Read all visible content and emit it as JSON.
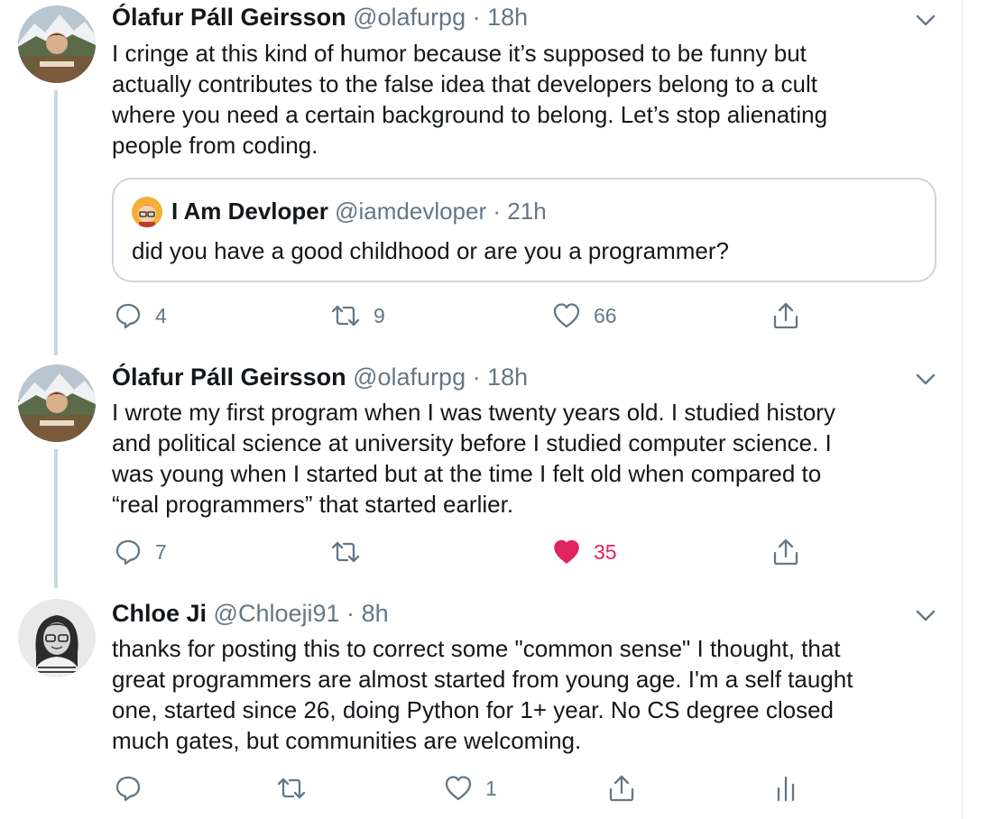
{
  "colors": {
    "text": "#14171a",
    "secondary": "#657786",
    "border": "#ccd6dd",
    "like": "#e0245e"
  },
  "tweets": [
    {
      "author_name": "Ólafur Páll Geirsson",
      "author_handle": "@olafurpg",
      "separator": "·",
      "time": "18h",
      "avatar_icon": "avatar-mountain-photo",
      "text": "I cringe at this kind of humor because it’s supposed to be funny but\nactually contributes to the false idea that developers belong to a cult\nwhere you need a certain background to belong. Let’s stop alienating\npeople from coding.",
      "quoted": {
        "author_name": "I Am Devloper",
        "author_handle": "@iamdevloper",
        "separator": "·",
        "time": "21h",
        "avatar_icon": "avatar-cartoon-developer",
        "text": "did you have a good childhood or are you a programmer?"
      },
      "reply_count": "4",
      "retweet_count": "9",
      "like_count": "66",
      "liked": false
    },
    {
      "author_name": "Ólafur Páll Geirsson",
      "author_handle": "@olafurpg",
      "separator": "·",
      "time": "18h",
      "avatar_icon": "avatar-mountain-photo",
      "text": "I wrote my first program when I was twenty years old. I studied history\nand political science at university before I studied computer science. I\nwas young when I started but at the time I felt old when compared to\n“real programmers” that started earlier.",
      "reply_count": "7",
      "retweet_count": "",
      "like_count": "35",
      "liked": true
    },
    {
      "author_name": "Chloe Ji",
      "author_handle": "@Chloeji91",
      "separator": "·",
      "time": "8h",
      "avatar_icon": "avatar-portrait-photo",
      "text": "thanks for posting this to correct some \"common sense\" I thought, that\ngreat programmers are almost started from young age. I'm a self taught\none, started since 26, doing Python for 1+ year. No CS degree closed\nmuch gates, but communities are welcoming.",
      "reply_count": "",
      "retweet_count": "",
      "like_count": "1",
      "liked": false
    }
  ],
  "icons": {
    "reply": "reply-icon",
    "retweet": "retweet-icon",
    "like": "heart-icon",
    "share": "share-icon",
    "analytics": "analytics-icon",
    "menu": "chevron-down-icon"
  }
}
